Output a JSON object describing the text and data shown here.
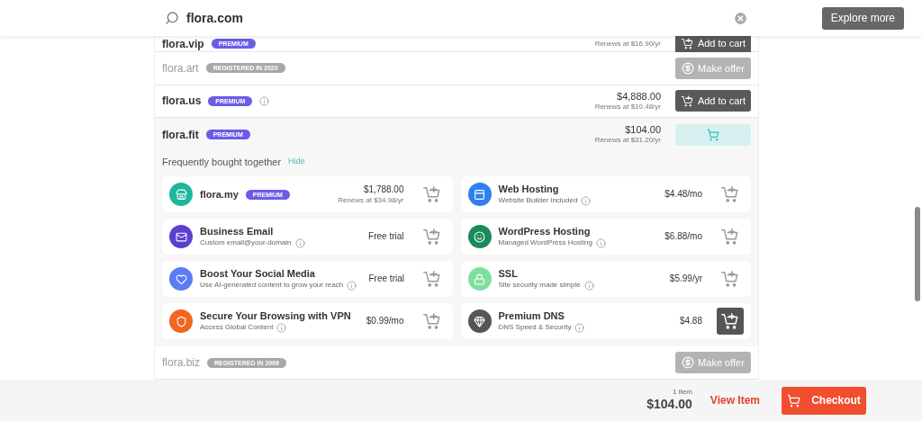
{
  "search": {
    "value": "flora.com",
    "explore_button": "Explore more"
  },
  "domains": [
    {
      "name": "flora.vip",
      "badge": "PREMIUM",
      "kind": "premium",
      "info": false,
      "renewal": "Renews at $16.90/yr",
      "action": {
        "kind": "add",
        "label": "Add to cart"
      }
    },
    {
      "name": "flora.art",
      "badge": "REGISTERED IN 2020",
      "kind": "registered",
      "info": false,
      "action": {
        "kind": "offer",
        "label": "Make offer"
      }
    },
    {
      "name": "flora.us",
      "badge": "PREMIUM",
      "kind": "premium",
      "info": true,
      "price": "$4,888.00",
      "renewal": "Renews at $10.48/yr",
      "action": {
        "kind": "add",
        "label": "Add to cart"
      }
    },
    {
      "name": "flora.fit",
      "badge": "PREMIUM",
      "kind": "premium",
      "info": false,
      "price": "$104.00",
      "renewal": "Renews at $31.20/yr",
      "action": {
        "kind": "in_cart"
      }
    }
  ],
  "bundle": {
    "title": "Frequently bought together",
    "hide_link": "Hide",
    "items": [
      {
        "title": "flora.my",
        "badge": "PREMIUM",
        "info": false,
        "price": "$1,788.00",
        "renewal": "Renews at $34.98/yr",
        "color": "#1fb79c",
        "selected": false
      },
      {
        "title": "Web Hosting",
        "subtitle": "Website Builder included",
        "info": true,
        "price": "$4.48/mo",
        "color": "#2f80ed",
        "selected": false
      },
      {
        "title": "Business Email",
        "subtitle": "Custom email@your-domain",
        "info": true,
        "price": "Free trial",
        "color": "#5c3fd1",
        "selected": false
      },
      {
        "title": "WordPress Hosting",
        "subtitle": "Managed WordPress Hosting",
        "info": true,
        "price": "$6.88/mo",
        "color": "#1b8a5a",
        "selected": false
      },
      {
        "title": "Boost Your Social Media",
        "subtitle": "Use AI-generated content to grow your reach",
        "info": true,
        "price": "Free trial",
        "color": "#5b7cf5",
        "selected": false
      },
      {
        "title": "SSL",
        "subtitle": "Site security made simple",
        "info": true,
        "price": "$5.99/yr",
        "color": "#7ee0a0",
        "selected": false
      },
      {
        "title": "Secure Your Browsing with VPN",
        "subtitle": "Access Global Content",
        "info": true,
        "price": "$0.99/mo",
        "color": "#f26522",
        "selected": false
      },
      {
        "title": "Premium DNS",
        "subtitle": "DNS Speed & Security",
        "info": true,
        "price": "$4.88",
        "color": "#555555",
        "selected": true
      }
    ]
  },
  "after": [
    {
      "name": "flora.biz",
      "badge": "REGISTERED IN 2009",
      "kind": "registered",
      "info": false,
      "action": {
        "kind": "offer",
        "label": "Make offer"
      }
    }
  ],
  "footer": {
    "count": "1 item",
    "total": "$104.00",
    "view_link": "View Item",
    "checkout": "Checkout"
  }
}
